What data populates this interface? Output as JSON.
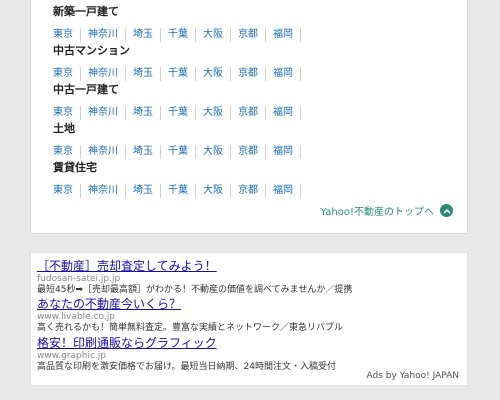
{
  "categories": [
    {
      "title": "新築一戸建て",
      "links": [
        "東京",
        "神奈川",
        "埼玉",
        "千葉",
        "大阪",
        "京都",
        "福岡"
      ]
    },
    {
      "title": "中古マンション",
      "links": [
        "東京",
        "神奈川",
        "埼玉",
        "千葉",
        "大阪",
        "京都",
        "福岡"
      ]
    },
    {
      "title": "中古一戸建て",
      "links": [
        "東京",
        "神奈川",
        "埼玉",
        "千葉",
        "大阪",
        "京都",
        "福岡"
      ]
    },
    {
      "title": "土地",
      "links": [
        "東京",
        "神奈川",
        "埼玉",
        "千葉",
        "大阪",
        "京都",
        "福岡"
      ]
    },
    {
      "title": "賃貸住宅",
      "links": [
        "東京",
        "神奈川",
        "埼玉",
        "千葉",
        "大阪",
        "京都",
        "福岡"
      ]
    }
  ],
  "top_link": {
    "label": "Yahoo!不動産のトップへ",
    "icon": "chevron-up-circle-icon"
  },
  "ads": [
    {
      "title": "［不動産］売却査定してみよう！",
      "url": "fudosan-satei.jp.jp",
      "desc": "最短45秒➡［売却最高額］がわかる！不動産の価値を調べてみませんか／提携"
    },
    {
      "title": "あなたの不動産今いくら？",
      "url": "www.livable.co.jp",
      "desc": "高く売れるかも！簡単無料査定。豊富な実績とネットワーク／東急リバブル"
    },
    {
      "title": "格安！印刷通販ならグラフィック",
      "url": "www.graphic.jp",
      "desc": "高品質な印刷を激安価格でお届け。最短当日納期、24時間注文・入稿受付"
    }
  ],
  "ads_attribution": "Ads by Yahoo! JAPAN",
  "colors": {
    "link": "#1a6db8",
    "ad_title": "#1a0dab",
    "accent": "#2a8a74"
  }
}
